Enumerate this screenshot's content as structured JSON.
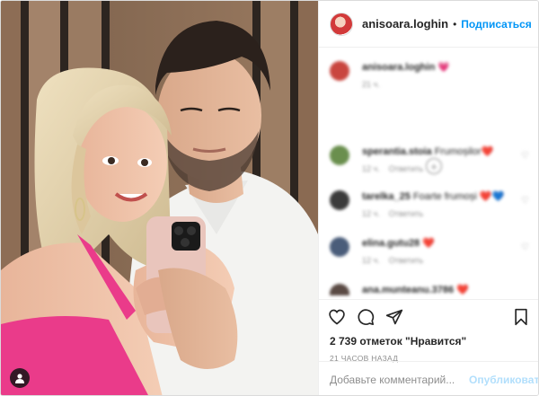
{
  "post": {
    "username": "anisoara.loghin",
    "separator": "•",
    "follow_label": "Подписаться",
    "avatar_icon": "profile-avatar",
    "tagged_icon": "person-icon"
  },
  "comments": {
    "author_caption": {
      "username": "anisoara.loghin",
      "emoji": "💗",
      "time": "21 ч."
    },
    "load_more_icon": "plus-circle-icon",
    "items": [
      {
        "username": "sperantia.stoia",
        "text": "Frumoșilor",
        "emoji": "❤️",
        "time": "12 ч.",
        "reply": "Ответить",
        "avatar_color": "#6a8f4e"
      },
      {
        "username": "tarelka_25",
        "text": "Foarte frumoși",
        "emoji": "❤️💙",
        "time": "12 ч.",
        "reply": "Ответить",
        "avatar_color": "#3b3b3b"
      },
      {
        "username": "elina.gutu28",
        "text": "",
        "emoji": "❤️",
        "time": "12 ч.",
        "reply": "Ответить",
        "avatar_color": "#4a5d7a"
      },
      {
        "username": "ana.munteanu.3786",
        "text": "",
        "emoji": "❤️",
        "time": "",
        "reply": "",
        "avatar_color": "#5a4a44"
      }
    ]
  },
  "actions": {
    "like_icon": "heart-icon",
    "comment_icon": "comment-icon",
    "share_icon": "paper-plane-icon",
    "save_icon": "bookmark-icon",
    "likes_text": "2 739 отметок \"Нравится\"",
    "time_ago": "21 ЧАСОВ НАЗАД"
  },
  "comment_form": {
    "placeholder": "Добавьте комментарий...",
    "submit_label": "Опубликовать"
  },
  "colors": {
    "accent": "#0095f6",
    "publish_disabled": "#b2dffc",
    "text": "#262626",
    "muted": "#8e8e8e",
    "border": "#efefef"
  }
}
